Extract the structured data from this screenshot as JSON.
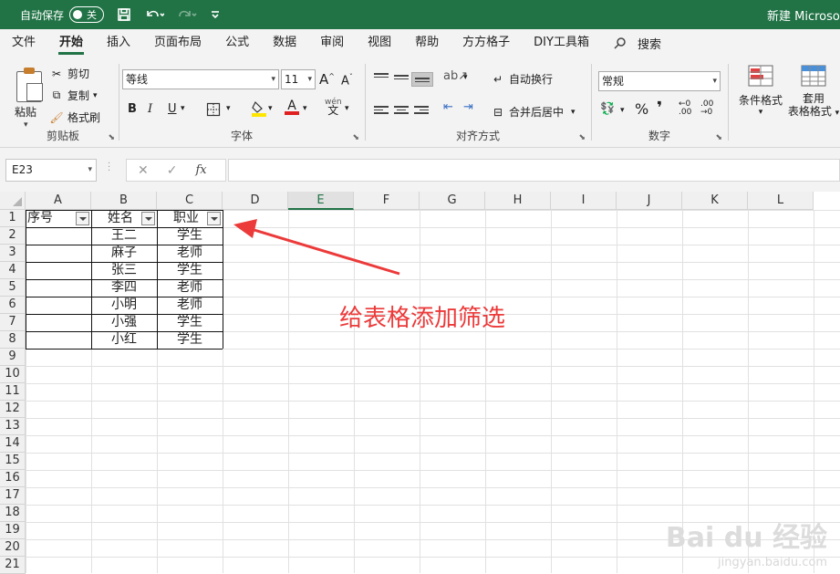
{
  "titlebar": {
    "autosave_label": "自动保存",
    "autosave_state": "关",
    "doc_title": "新建 Microsoft Excel 工作表 - Excel"
  },
  "tabs": [
    "文件",
    "开始",
    "插入",
    "页面布局",
    "公式",
    "数据",
    "审阅",
    "视图",
    "帮助",
    "方方格子",
    "DIY工具箱"
  ],
  "active_tab": "开始",
  "search_label": "搜索",
  "ribbon": {
    "clipboard": {
      "label": "剪贴板",
      "paste": "粘贴",
      "cut": "剪切",
      "copy": "复制",
      "format_painter": "格式刷"
    },
    "font": {
      "label": "字体",
      "font_name": "等线",
      "font_size": "11",
      "grow": "A",
      "shrink": "A",
      "bold": "B",
      "italic": "I",
      "underline": "U",
      "phonetic": "文"
    },
    "alignment": {
      "label": "对齐方式",
      "wrap": "自动换行",
      "merge": "合并后居中"
    },
    "number": {
      "label": "数字",
      "format": "常规",
      "percent": "%",
      "comma": "❜"
    },
    "styles": {
      "conditional": "条件格式",
      "table_line1": "套用",
      "table_line2": "表格格式"
    }
  },
  "formula_bar": {
    "name_box": "E23",
    "fx": "fx",
    "content": ""
  },
  "columns": [
    "A",
    "B",
    "C",
    "D",
    "E",
    "F",
    "G",
    "H",
    "I",
    "J",
    "K",
    "L"
  ],
  "active_column": "E",
  "rows": [
    "1",
    "2",
    "3",
    "4",
    "5",
    "6",
    "7",
    "8",
    "9",
    "10",
    "11",
    "12",
    "13",
    "14",
    "15",
    "16",
    "17",
    "18",
    "19",
    "20",
    "21"
  ],
  "table": {
    "headers": [
      "序号",
      "姓名",
      "职业"
    ],
    "data": [
      [
        "",
        "王二",
        "学生"
      ],
      [
        "",
        "麻子",
        "老师"
      ],
      [
        "",
        "张三",
        "学生"
      ],
      [
        "",
        "李四",
        "老师"
      ],
      [
        "",
        "小明",
        "老师"
      ],
      [
        "",
        "小强",
        "学生"
      ],
      [
        "",
        "小红",
        "学生"
      ]
    ]
  },
  "annotation": "给表格添加筛选",
  "watermark": {
    "main": "Bai du 经验",
    "sub": "jingyan.baidu.com"
  },
  "colors": {
    "excel_green": "#217346",
    "annotation_red": "#ec3a3a"
  }
}
